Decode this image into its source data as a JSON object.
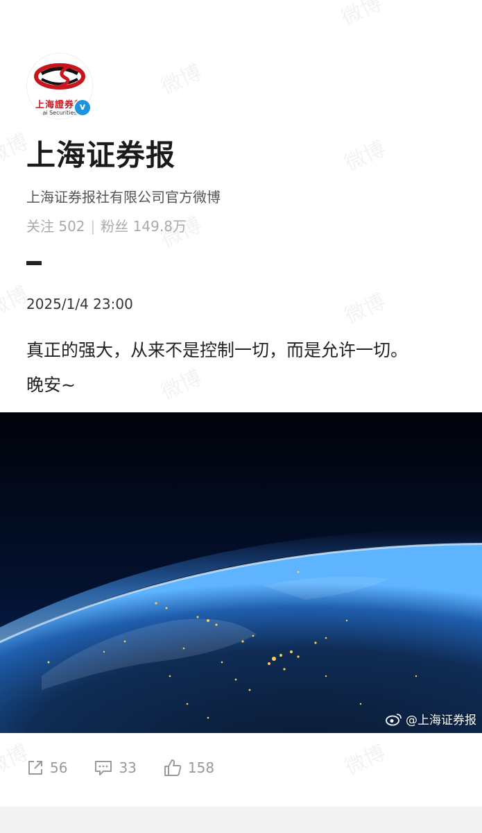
{
  "watermark_text": "微博",
  "profile": {
    "avatar_text": "上海證券報",
    "avatar_sub": "ai Securities",
    "verified_mark": "v",
    "name": "上海证券报",
    "description": "上海证券报社有限公司官方微博",
    "following_label": "关注",
    "following_count": "502",
    "followers_label": "粉丝",
    "followers_count": "149.8万"
  },
  "post": {
    "timestamp": "2025/1/4 23:00",
    "text_line1": "真正的强大，从来不是控制一切，而是允许一切。",
    "text_line2": "晚安~",
    "image_watermark": "@上海证券报"
  },
  "actions": {
    "share_count": "56",
    "comment_count": "33",
    "like_count": "158"
  },
  "colors": {
    "brand_red": "#c8161d",
    "verified_blue": "#1b95e0",
    "muted_text": "#a9a9a9"
  }
}
